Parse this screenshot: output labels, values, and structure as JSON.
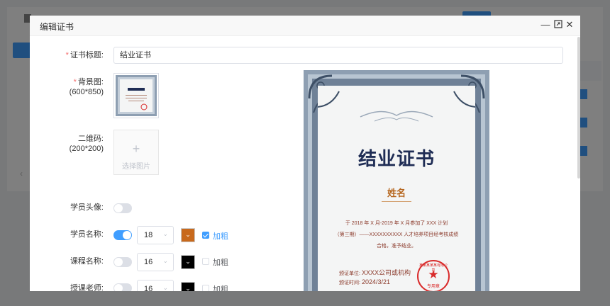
{
  "dialog": {
    "title": "编辑证书",
    "minimize_icon": "minimize-icon",
    "maximize_icon": "maximize-icon",
    "close_icon": "close-icon"
  },
  "form": {
    "cert_title": {
      "label": "证书标题:",
      "value": "结业证书"
    },
    "background": {
      "label": "背景图:",
      "size_hint": "(600*850)"
    },
    "qrcode": {
      "label": "二维码:",
      "size_hint": "(200*200)",
      "upload_text": "选择图片",
      "upload_icon": "plus-icon"
    },
    "avatar": {
      "label": "学员头像:",
      "enabled": false
    },
    "student_name": {
      "label": "学员名称:",
      "enabled": true,
      "font_size": "18",
      "color": "#c8691c",
      "bold": true,
      "bold_label": "加粗"
    },
    "course_name": {
      "label": "课程名称:",
      "enabled": false,
      "font_size": "16",
      "color": "#000000",
      "bold": false,
      "bold_label": "加粗"
    },
    "teacher": {
      "label": "授课老师:",
      "enabled": false,
      "font_size": "16",
      "color": "#000000",
      "bold": false,
      "bold_label": "加粗"
    }
  },
  "preview": {
    "title": "结业证书",
    "name": "姓名",
    "line1": "于 2018 年 X 月-2019 年 X 月参加了 XXX 计划",
    "line2": "（第三期）——XXXXXXXXXX 人才培养项目经考核成绩",
    "line3": "合格，准予结业。",
    "issuer_label": "颁证单位:",
    "issuer_value": "XXXX公司或机构",
    "date_label": "颁证时间:",
    "date_value": "2024/3/21",
    "seal_ring": "某某某某某有限公司",
    "seal_bottom": "专用章"
  },
  "colors": {
    "accent": "#409eff",
    "required": "#f56c6c",
    "cert_title": "#1f2d55",
    "cert_name": "#b5651d",
    "seal": "#d92b2b"
  }
}
